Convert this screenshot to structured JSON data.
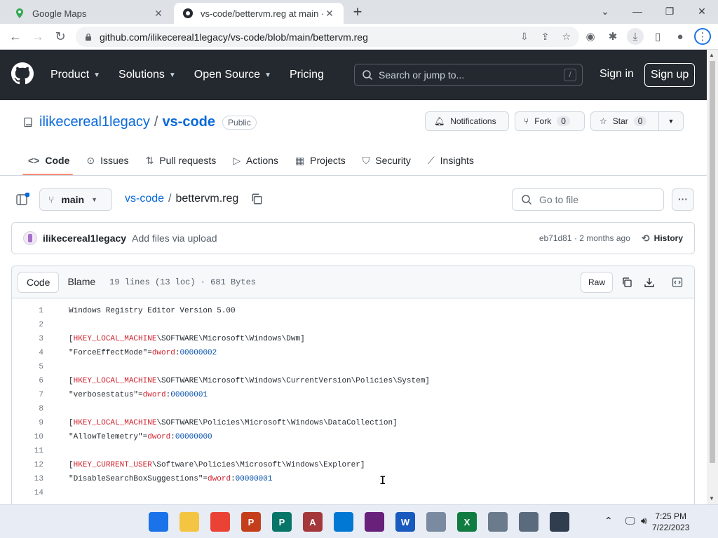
{
  "browser": {
    "tabs": [
      {
        "title": "Google Maps",
        "active": false
      },
      {
        "title": "vs-code/bettervm.reg at main · il…",
        "active": true
      }
    ],
    "new_tab": "+",
    "url": "github.com/ilikecereal1legacy/vs-code/blob/main/bettervm.reg"
  },
  "gh_header": {
    "nav": [
      "Product",
      "Solutions",
      "Open Source",
      "Pricing"
    ],
    "search_placeholder": "Search or jump to...",
    "search_key": "/",
    "signin": "Sign in",
    "signup": "Sign up"
  },
  "repo": {
    "owner": "ilikecereal1legacy",
    "separator": "/",
    "name": "vs-code",
    "visibility": "Public",
    "notifications": "Notifications",
    "fork_label": "Fork",
    "fork_count": "0",
    "star_label": "Star",
    "star_count": "0",
    "tabs": [
      "Code",
      "Issues",
      "Pull requests",
      "Actions",
      "Projects",
      "Security",
      "Insights"
    ]
  },
  "file_nav": {
    "branch": "main",
    "repo_link": "vs-code",
    "sep": "/",
    "filename": "bettervm.reg",
    "goto_placeholder": "Go to file"
  },
  "commit": {
    "author": "ilikecereal1legacy",
    "message": "Add files via upload",
    "meta": "eb71d81 · 2 months ago",
    "history": "History"
  },
  "code_header": {
    "code_tab": "Code",
    "blame_tab": "Blame",
    "info": "19 lines (13 loc) · 681 Bytes",
    "raw": "Raw"
  },
  "code_lines": [
    {
      "n": "1",
      "parts": [
        {
          "t": "Windows Registry Editor Version 5.00",
          "c": ""
        }
      ]
    },
    {
      "n": "2",
      "parts": []
    },
    {
      "n": "3",
      "parts": [
        {
          "t": "[",
          "c": ""
        },
        {
          "t": "HKEY_LOCAL_MACHINE",
          "c": "kw"
        },
        {
          "t": "\\SOFTWARE\\Microsoft\\Windows\\Dwm]",
          "c": ""
        }
      ]
    },
    {
      "n": "4",
      "parts": [
        {
          "t": "\"ForceEffectMode\"=",
          "c": ""
        },
        {
          "t": "dword",
          "c": "kw"
        },
        {
          "t": ":",
          "c": ""
        },
        {
          "t": "00000002",
          "c": "num"
        }
      ]
    },
    {
      "n": "5",
      "parts": []
    },
    {
      "n": "6",
      "parts": [
        {
          "t": "[",
          "c": ""
        },
        {
          "t": "HKEY_LOCAL_MACHINE",
          "c": "kw"
        },
        {
          "t": "\\SOFTWARE\\Microsoft\\Windows\\CurrentVersion\\Policies\\System]",
          "c": ""
        }
      ]
    },
    {
      "n": "7",
      "parts": [
        {
          "t": "\"verbosestatus\"=",
          "c": ""
        },
        {
          "t": "dword",
          "c": "kw"
        },
        {
          "t": ":",
          "c": ""
        },
        {
          "t": "00000001",
          "c": "num"
        }
      ]
    },
    {
      "n": "8",
      "parts": []
    },
    {
      "n": "9",
      "parts": [
        {
          "t": "[",
          "c": ""
        },
        {
          "t": "HKEY_LOCAL_MACHINE",
          "c": "kw"
        },
        {
          "t": "\\SOFTWARE\\Policies\\Microsoft\\Windows\\DataCollection]",
          "c": ""
        }
      ]
    },
    {
      "n": "10",
      "parts": [
        {
          "t": "\"AllowTelemetry\"=",
          "c": ""
        },
        {
          "t": "dword",
          "c": "kw"
        },
        {
          "t": ":",
          "c": ""
        },
        {
          "t": "00000000",
          "c": "num"
        }
      ]
    },
    {
      "n": "11",
      "parts": []
    },
    {
      "n": "12",
      "parts": [
        {
          "t": "[",
          "c": ""
        },
        {
          "t": "HKEY_CURRENT_USER",
          "c": "kw"
        },
        {
          "t": "\\Software\\Policies\\Microsoft\\Windows\\Explorer]",
          "c": ""
        }
      ]
    },
    {
      "n": "13",
      "parts": [
        {
          "t": "\"DisableSearchBoxSuggestions\"=",
          "c": ""
        },
        {
          "t": "dword",
          "c": "kw"
        },
        {
          "t": ":",
          "c": ""
        },
        {
          "t": "00000001",
          "c": "num"
        }
      ]
    },
    {
      "n": "14",
      "parts": []
    }
  ],
  "taskbar": {
    "apps": [
      {
        "name": "start",
        "label": "",
        "color": "#1a73e8"
      },
      {
        "name": "file-explorer",
        "label": "",
        "color": "#f4c542"
      },
      {
        "name": "chrome",
        "label": "",
        "color": "#ea4335"
      },
      {
        "name": "powerpoint",
        "label": "P",
        "color": "#c43e1c"
      },
      {
        "name": "publisher",
        "label": "P",
        "color": "#077568"
      },
      {
        "name": "access",
        "label": "A",
        "color": "#a4373a"
      },
      {
        "name": "vscode",
        "label": "",
        "color": "#0078d4"
      },
      {
        "name": "visual-studio",
        "label": "",
        "color": "#68217a"
      },
      {
        "name": "word",
        "label": "W",
        "color": "#185abd"
      },
      {
        "name": "control-panel",
        "label": "",
        "color": "#7a8aa0"
      },
      {
        "name": "excel",
        "label": "X",
        "color": "#107c41"
      },
      {
        "name": "notepad",
        "label": "",
        "color": "#6b7b8c"
      },
      {
        "name": "settings",
        "label": "",
        "color": "#5a6b7d"
      },
      {
        "name": "calculator",
        "label": "",
        "color": "#2f3d4f"
      }
    ],
    "time": "7:25 PM",
    "date": "7/22/2023"
  }
}
